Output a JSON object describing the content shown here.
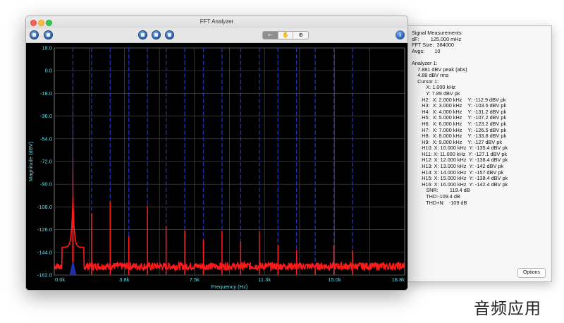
{
  "window": {
    "title": "FFT Analyzer",
    "toolbar_segments": [
      "⇠",
      "✋",
      "⊕"
    ],
    "help_label": "i"
  },
  "side_panel": {
    "lines": [
      "Signal Measurements:",
      "dF:        125.000 mHz",
      "FFT Size:  384000",
      "Avgs:       10",
      "",
      "Analyzer 1:",
      "    7.881 dBV peak (abs)",
      "    4.88 dBV rms",
      "    Cursor 1:",
      "          X: 1.000 kHz",
      "          Y: 7.89 dBV pk",
      "       H2:  X: 2.000 kHz    Y: -112.9 dBV pk",
      "       H3:  X: 3.000 kHz    Y: -103.5 dBV pk",
      "       H4:  X: 4.000 kHz    Y: -131.2 dBV pk",
      "       H5:  X: 5.000 kHz    Y: -107.2 dBV pk",
      "       H6:  X: 6.000 kHz    Y: -123.2 dBV pk",
      "       H7:  X: 7.000 kHz    Y: -126.5 dBV pk",
      "       H8:  X: 8.000 kHz    Y: -133.8 dBV pk",
      "       H9:  X: 9.000 kHz    Y: -127 dBV pk",
      "       H10: X: 10.000 kHz  Y: -135.4 dBV pk",
      "       H11: X: 11.000 kHz  Y: -127.1 dBV pk",
      "       H12: X: 12.000 kHz  Y: -138.4 dBV pk",
      "       H13: X: 13.000 kHz  Y: -142 dBV pk",
      "       H14: X: 14.000 kHz  Y: -157 dBV pk",
      "       H15: X: 15.000 kHz  Y: -138.4 dBV pk",
      "       H16: X: 16.000 kHz  Y: -142.4 dBV pk",
      "          SNR:        119.4 dB",
      "          THD:-109.4 dB",
      "          THD+N:   -109 dB"
    ],
    "options_label": "Options"
  },
  "watermark": "音频应用",
  "colors": {
    "plot_bg": "#000000",
    "grid": "#4a4a4a",
    "trace": "#ff1a1a",
    "cursor": "#1f2fa8",
    "axis_text": "#6fd8e0"
  },
  "chart_data": {
    "type": "line",
    "xlabel": "Frequency (Hz)",
    "ylabel": "Magnitude (dBV)",
    "xlim": [
      0,
      18800
    ],
    "ylim": [
      -162,
      18
    ],
    "x_tick_labels": [
      "0.0k",
      "3.8k",
      "7.5k",
      "11.3k",
      "15.0k",
      "18.8k"
    ],
    "x_tick_values": [
      0,
      3760,
      7520,
      11280,
      15040,
      18800
    ],
    "y_ticks": [
      18.0,
      0.0,
      -18.0,
      -36.0,
      -54.0,
      -72.0,
      -90.0,
      -108.0,
      -126.0,
      -144.0,
      -162.0
    ],
    "y_tick_labels": [
      "18.0",
      "0.0",
      "-18.0",
      "-36.0",
      "-54.0",
      "-72.0",
      "-90.0",
      "-108.0",
      "-126.0",
      "-144.0",
      "-162.0"
    ],
    "grid": true,
    "noise_floor": -155,
    "fundamental": {
      "x": 1000,
      "y": 7.89
    },
    "harmonics": [
      {
        "x": 2000,
        "y": -112.9
      },
      {
        "x": 3000,
        "y": -103.5
      },
      {
        "x": 4000,
        "y": -131.2
      },
      {
        "x": 5000,
        "y": -107.2
      },
      {
        "x": 6000,
        "y": -123.2
      },
      {
        "x": 7000,
        "y": -126.5
      },
      {
        "x": 8000,
        "y": -133.8
      },
      {
        "x": 9000,
        "y": -127
      },
      {
        "x": 10000,
        "y": -135.4
      },
      {
        "x": 11000,
        "y": -127.1
      },
      {
        "x": 12000,
        "y": -138.4
      },
      {
        "x": 13000,
        "y": -142
      },
      {
        "x": 14000,
        "y": -157
      },
      {
        "x": 15000,
        "y": -138.4
      },
      {
        "x": 16000,
        "y": -142.4
      }
    ],
    "cursor_x": [
      1000,
      2000,
      3000,
      4000,
      5000,
      6000,
      7000,
      8000,
      9000,
      10000,
      11000,
      12000,
      13000,
      14000,
      15000,
      16000
    ]
  }
}
